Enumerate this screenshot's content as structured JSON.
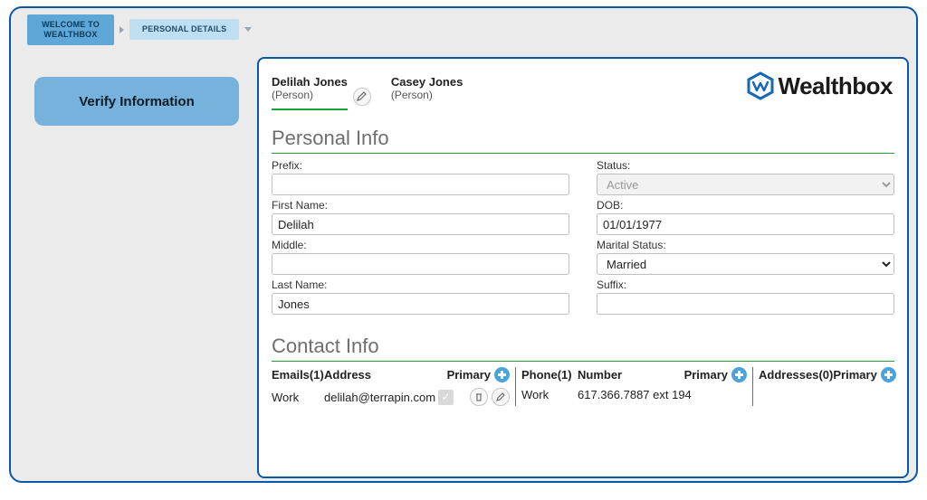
{
  "breadcrumbs": {
    "welcome_line1": "WELCOME TO",
    "welcome_line2": "WEALTHBOX",
    "personal": "PERSONAL DETAILS"
  },
  "sidebar": {
    "verify_label": "Verify Information"
  },
  "brand": {
    "name": "Wealthbox"
  },
  "persons": {
    "tab1": {
      "name": "Delilah Jones",
      "type": "(Person)"
    },
    "tab2": {
      "name": "Casey Jones",
      "type": "(Person)"
    }
  },
  "sections": {
    "personal": "Personal Info",
    "contact": "Contact Info"
  },
  "form": {
    "prefix_label": "Prefix:",
    "prefix_value": "",
    "first_label": "First Name:",
    "first_value": "Delilah",
    "middle_label": "Middle:",
    "middle_value": "",
    "last_label": "Last Name:",
    "last_value": "Jones",
    "status_label": "Status:",
    "status_value": "Active",
    "dob_label": "DOB:",
    "dob_value": "01/01/1977",
    "marital_label": "Marital Status:",
    "marital_value": "Married",
    "suffix_label": "Suffix:",
    "suffix_value": ""
  },
  "contact": {
    "emails_header": "Emails(1)",
    "address_header": "Address",
    "primary_header": "Primary",
    "phone_header": "Phone(1)",
    "number_header": "Number",
    "addresses_header": "Addresses(0)",
    "email_row": {
      "label": "Work",
      "address": "delilah@terrapin.com"
    },
    "phone_row": {
      "label": "Work",
      "number": "617.366.7887 ext 194"
    }
  }
}
